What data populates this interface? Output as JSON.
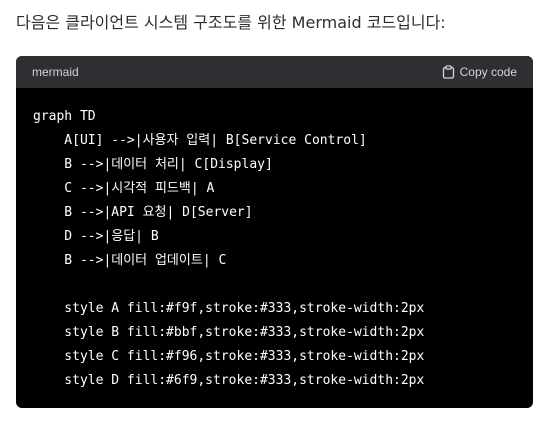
{
  "intro_text": "다음은 클라이언트 시스템 구조도를 위한 Mermaid 코드입니다:",
  "code_block": {
    "language": "mermaid",
    "copy_label": "Copy code",
    "copy_icon": "clipboard-icon",
    "lines": [
      "graph TD",
      "    A[UI] -->|사용자 입력| B[Service Control]",
      "    B -->|데이터 처리| C[Display]",
      "    C -->|시각적 피드백| A",
      "    B -->|API 요청| D[Server]",
      "    D -->|응답| B",
      "    B -->|데이터 업데이트| C",
      "",
      "    style A fill:#f9f,stroke:#333,stroke-width:2px",
      "    style B fill:#bbf,stroke:#333,stroke-width:2px",
      "    style C fill:#f96,stroke:#333,stroke-width:2px",
      "    style D fill:#6f9,stroke:#333,stroke-width:2px"
    ]
  },
  "colors": {
    "header_bg": "#2f2f33",
    "code_bg": "#000000",
    "text": "#2d2d2d"
  }
}
